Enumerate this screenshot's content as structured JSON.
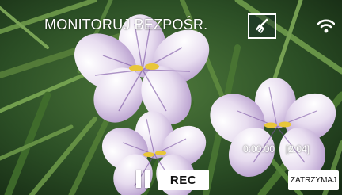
{
  "header": {
    "title": "MONITORUJ BEZPOŚR.",
    "mode_icon": "broom-icon",
    "status_icon": "wifi-icon"
  },
  "recording": {
    "elapsed": "0:00:00",
    "remaining": "[2:04]"
  },
  "controls": {
    "pause_icon": "pause-icon",
    "rec_label": "REC",
    "stop_label": "ZATRZYMAJ"
  },
  "colors": {
    "overlay_text": "#ffffff",
    "button_bg": "#ffffff",
    "button_text": "#111111"
  }
}
